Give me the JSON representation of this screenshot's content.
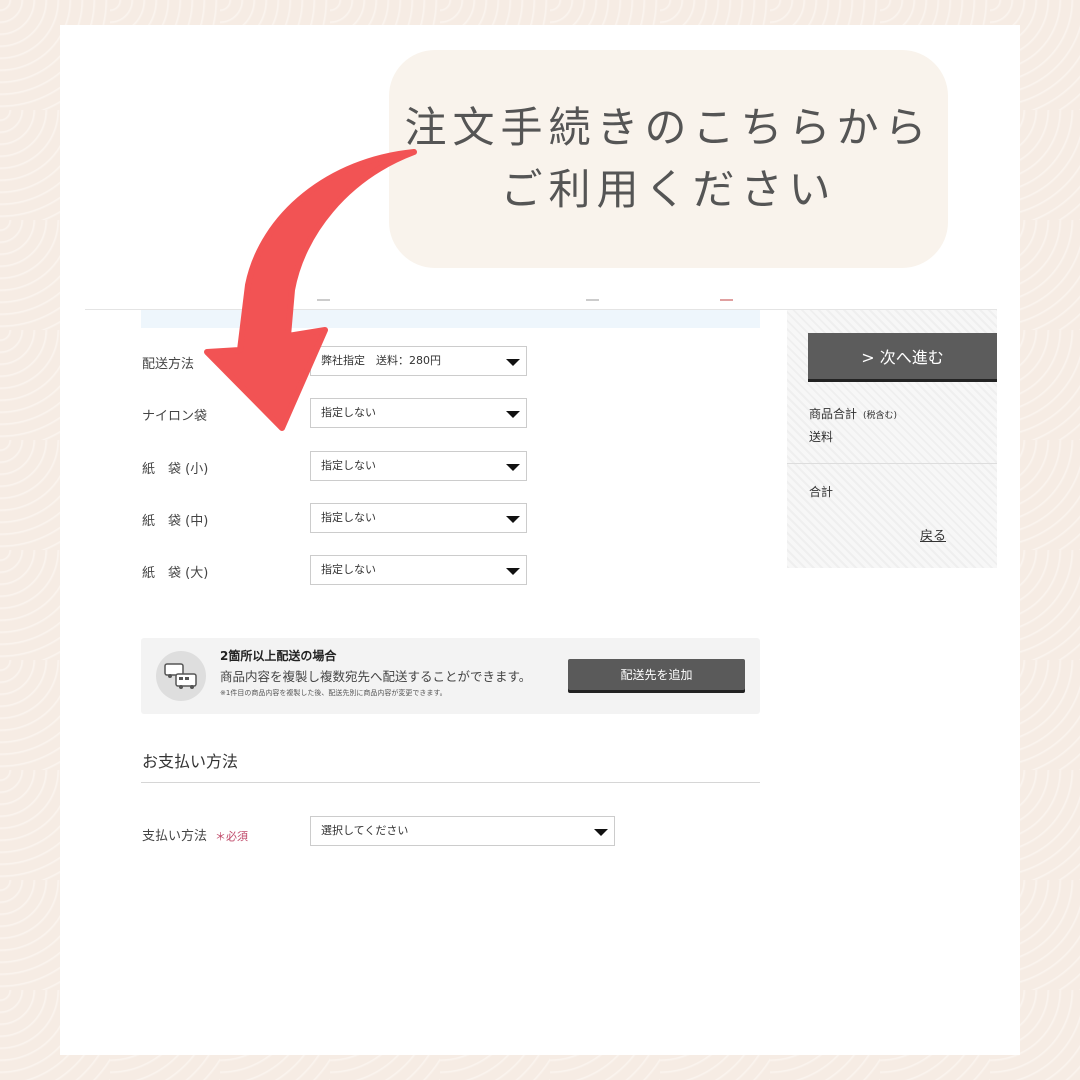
{
  "callout": {
    "line1": "注文手続きのこちらから",
    "line2": "ご利用ください"
  },
  "shipping_rows": [
    {
      "label": "配送方法",
      "value": "弊社指定　送料：280円"
    },
    {
      "label": "ナイロン袋",
      "value": "指定しない"
    },
    {
      "label": "紙　袋 (小)",
      "value": "指定しない"
    },
    {
      "label": "紙　袋 (中)",
      "value": "指定しない"
    },
    {
      "label": "紙　袋 (大)",
      "value": "指定しない"
    }
  ],
  "multi_ship": {
    "title": "2箇所以上配送の場合",
    "desc": "商品内容を複製し複数宛先へ配送することができます。",
    "note": "※1件目の商品内容を複製した後、配送先別に商品内容が変更できます。",
    "button": "配送先を追加"
  },
  "payment": {
    "heading": "お支払い方法",
    "label": "支払い方法",
    "required": "＊必須",
    "placeholder": "選択してください"
  },
  "sidebar": {
    "next_button": "> 次へ進む",
    "subtotal_label": "商品合計",
    "tax_note": "(税含む)",
    "shipping_label": "送料",
    "total_label": "合計",
    "back_link": "戻る"
  },
  "colors": {
    "arrow": "#f25354",
    "button": "#5a5a5a",
    "required": "#c04a6a"
  }
}
